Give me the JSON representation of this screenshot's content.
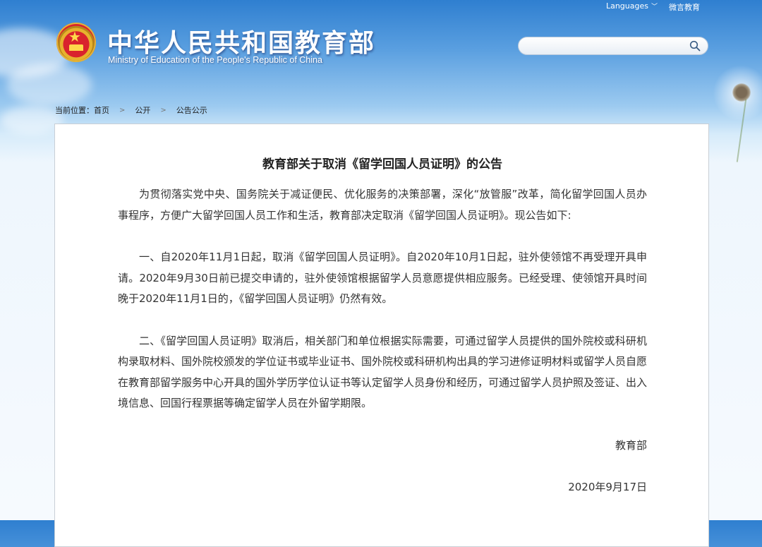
{
  "header": {
    "languages_label": "Languages",
    "weibo_label": "微言教育",
    "site_title": "中华人民共和国教育部",
    "site_subtitle": "Ministry of Education of the People's Republic of China",
    "search_placeholder": ""
  },
  "breadcrumb": {
    "prefix": "当前位置：",
    "items": [
      "首页",
      "公开",
      "公告公示"
    ],
    "separator": ">"
  },
  "article": {
    "title": "教育部关于取消《留学回国人员证明》的公告",
    "paragraphs": [
      "为贯彻落实党中央、国务院关于减证便民、优化服务的决策部署，深化“放管服”改革，简化留学回国人员办事程序，方便广大留学回国人员工作和生活，教育部决定取消《留学回国人员证明》。现公告如下:",
      "一、自2020年11月1日起，取消《留学回国人员证明》。自2020年10月1日起，驻外使领馆不再受理开具申请。2020年9月30日前已提交申请的，驻外使领馆根据留学人员意愿提供相应服务。已经受理、使领馆开具时间晚于2020年11月1日的，《留学回国人员证明》仍然有效。",
      "二、《留学回国人员证明》取消后，相关部门和单位根据实际需要，可通过留学人员提供的国外院校或科研机构录取材料、国外院校颁发的学位证书或毕业证书、国外院校或科研机构出具的学习进修证明材料或留学人员自愿在教育部留学服务中心开具的国外学历学位认证书等认定留学人员身份和经历，可通过留学人员护照及签证、出入境信息、回国行程票据等确定留学人员在外留学期限。"
    ],
    "signature": "教育部",
    "date": "2020年9月17日"
  },
  "colors": {
    "sky_top": "#2f7fd0",
    "text": "#333333",
    "panel_border": "#c9cfd6"
  },
  "icons": [
    "national-emblem-icon",
    "search-icon",
    "chevron-down-icon"
  ]
}
